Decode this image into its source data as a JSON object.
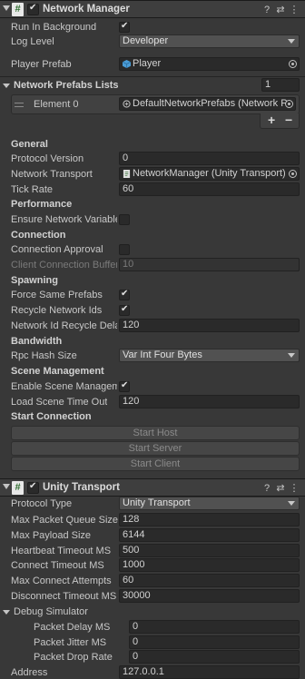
{
  "network_manager": {
    "title": "Network Manager",
    "script_glyph": "#",
    "enabled": true,
    "icons": [
      "help-icon",
      "preset-icon",
      "more-icon"
    ],
    "fields": {
      "run_in_background": {
        "label": "Run In Background",
        "checked": true
      },
      "log_level": {
        "label": "Log Level",
        "value": "Developer"
      },
      "player_prefab": {
        "label": "Player Prefab",
        "value": "Player"
      }
    },
    "network_prefabs_lists": {
      "label": "Network Prefabs Lists",
      "count": "1",
      "element_label": "Element 0",
      "element_value": "DefaultNetworkPrefabs (Network P"
    },
    "general": {
      "heading": "General",
      "protocol_version": {
        "label": "Protocol Version",
        "value": "0"
      },
      "network_transport": {
        "label": "Network Transport",
        "value": "NetworkManager (Unity Transport)"
      },
      "tick_rate": {
        "label": "Tick Rate",
        "value": "60"
      }
    },
    "performance": {
      "heading": "Performance",
      "ensure_network_variable": {
        "label": "Ensure Network Variable",
        "checked": false
      }
    },
    "connection": {
      "heading": "Connection",
      "connection_approval": {
        "label": "Connection Approval",
        "checked": false
      },
      "client_connection_buffer": {
        "label": "Client Connection Buffer",
        "value": "10"
      }
    },
    "spawning": {
      "heading": "Spawning",
      "force_same_prefabs": {
        "label": "Force Same Prefabs",
        "checked": true
      },
      "recycle_network_ids": {
        "label": "Recycle Network Ids",
        "checked": true
      },
      "network_id_recycle_delay": {
        "label": "Network Id Recycle Dela",
        "value": "120"
      }
    },
    "bandwidth": {
      "heading": "Bandwidth",
      "rpc_hash_size": {
        "label": "Rpc Hash Size",
        "value": "Var Int Four Bytes"
      }
    },
    "scene_management": {
      "heading": "Scene Management",
      "enable_scene_management": {
        "label": "Enable Scene Manageme",
        "checked": true
      },
      "load_scene_time_out": {
        "label": "Load Scene Time Out",
        "value": "120"
      }
    },
    "start_connection": {
      "heading": "Start Connection",
      "start_host": "Start Host",
      "start_server": "Start Server",
      "start_client": "Start Client"
    }
  },
  "unity_transport": {
    "title": "Unity Transport",
    "script_glyph": "#",
    "enabled": true,
    "protocol_type": {
      "label": "Protocol Type",
      "value": "Unity Transport"
    },
    "max_packet_queue_size": {
      "label": "Max Packet Queue Size",
      "value": "128"
    },
    "max_payload_size": {
      "label": "Max Payload Size",
      "value": "6144"
    },
    "heartbeat_timeout_ms": {
      "label": "Heartbeat Timeout MS",
      "value": "500"
    },
    "connect_timeout_ms": {
      "label": "Connect Timeout MS",
      "value": "1000"
    },
    "max_connect_attempts": {
      "label": "Max Connect Attempts",
      "value": "60"
    },
    "disconnect_timeout_ms": {
      "label": "Disconnect Timeout MS",
      "value": "30000"
    },
    "debug_simulator": {
      "label": "Debug Simulator",
      "packet_delay_ms": {
        "label": "Packet Delay MS",
        "value": "0"
      },
      "packet_jitter_ms": {
        "label": "Packet Jitter MS",
        "value": "0"
      },
      "packet_drop_rate": {
        "label": "Packet Drop Rate",
        "value": "0"
      }
    },
    "address": {
      "label": "Address",
      "value": "127.0.0.1"
    }
  },
  "colors": {
    "background": "#383838",
    "field": "#2a2a2a",
    "header": "#3e3e3e",
    "dropdown": "#515151",
    "script_icon_text": "#2f6e2f"
  }
}
